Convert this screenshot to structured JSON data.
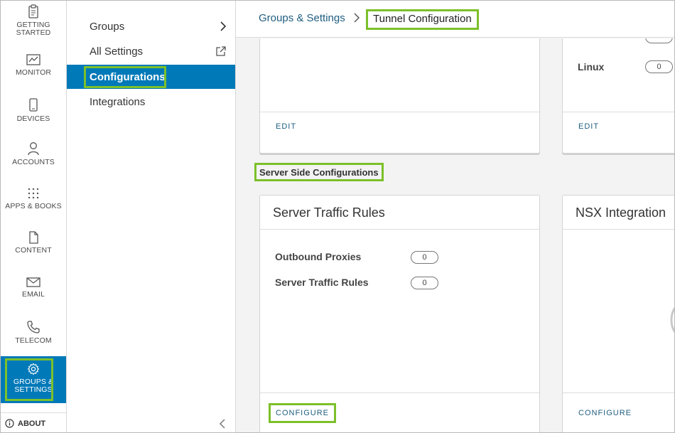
{
  "iconnav": {
    "items": [
      {
        "label": "GETTING STARTED",
        "icon": "clipboard-icon"
      },
      {
        "label": "MONITOR",
        "icon": "chart-icon"
      },
      {
        "label": "DEVICES",
        "icon": "phone-icon"
      },
      {
        "label": "ACCOUNTS",
        "icon": "user-icon"
      },
      {
        "label": "APPS & BOOKS",
        "icon": "apps-grid-icon"
      },
      {
        "label": "CONTENT",
        "icon": "document-icon"
      },
      {
        "label": "EMAIL",
        "icon": "envelope-icon"
      },
      {
        "label": "TELECOM",
        "icon": "telephone-icon"
      },
      {
        "label": "GROUPS & SETTINGS",
        "icon": "gear-icon",
        "active": true
      }
    ],
    "about": "ABOUT"
  },
  "submenu": {
    "items": [
      {
        "label": "Groups"
      },
      {
        "label": "All Settings"
      },
      {
        "label": "Configurations",
        "active": true
      },
      {
        "label": "Integrations"
      }
    ]
  },
  "breadcrumb": {
    "parent": "Groups & Settings",
    "current": "Tunnel Configuration"
  },
  "top_cards": {
    "left": {
      "action": "EDIT"
    },
    "right": {
      "row_label": "Linux",
      "row_value": "0",
      "action": "EDIT"
    }
  },
  "section": {
    "title": "Server Side Configurations"
  },
  "server_cards": {
    "traffic": {
      "title": "Server Traffic Rules",
      "rows": [
        {
          "label": "Outbound Proxies",
          "value": "0"
        },
        {
          "label": "Server Traffic Rules",
          "value": "0"
        }
      ],
      "action": "CONFIGURE"
    },
    "nsx": {
      "title": "NSX Integration",
      "action": "CONFIGURE"
    }
  },
  "colors": {
    "accent": "#0079b8",
    "highlight": "#7cc02a",
    "link": "#1f5d80"
  }
}
